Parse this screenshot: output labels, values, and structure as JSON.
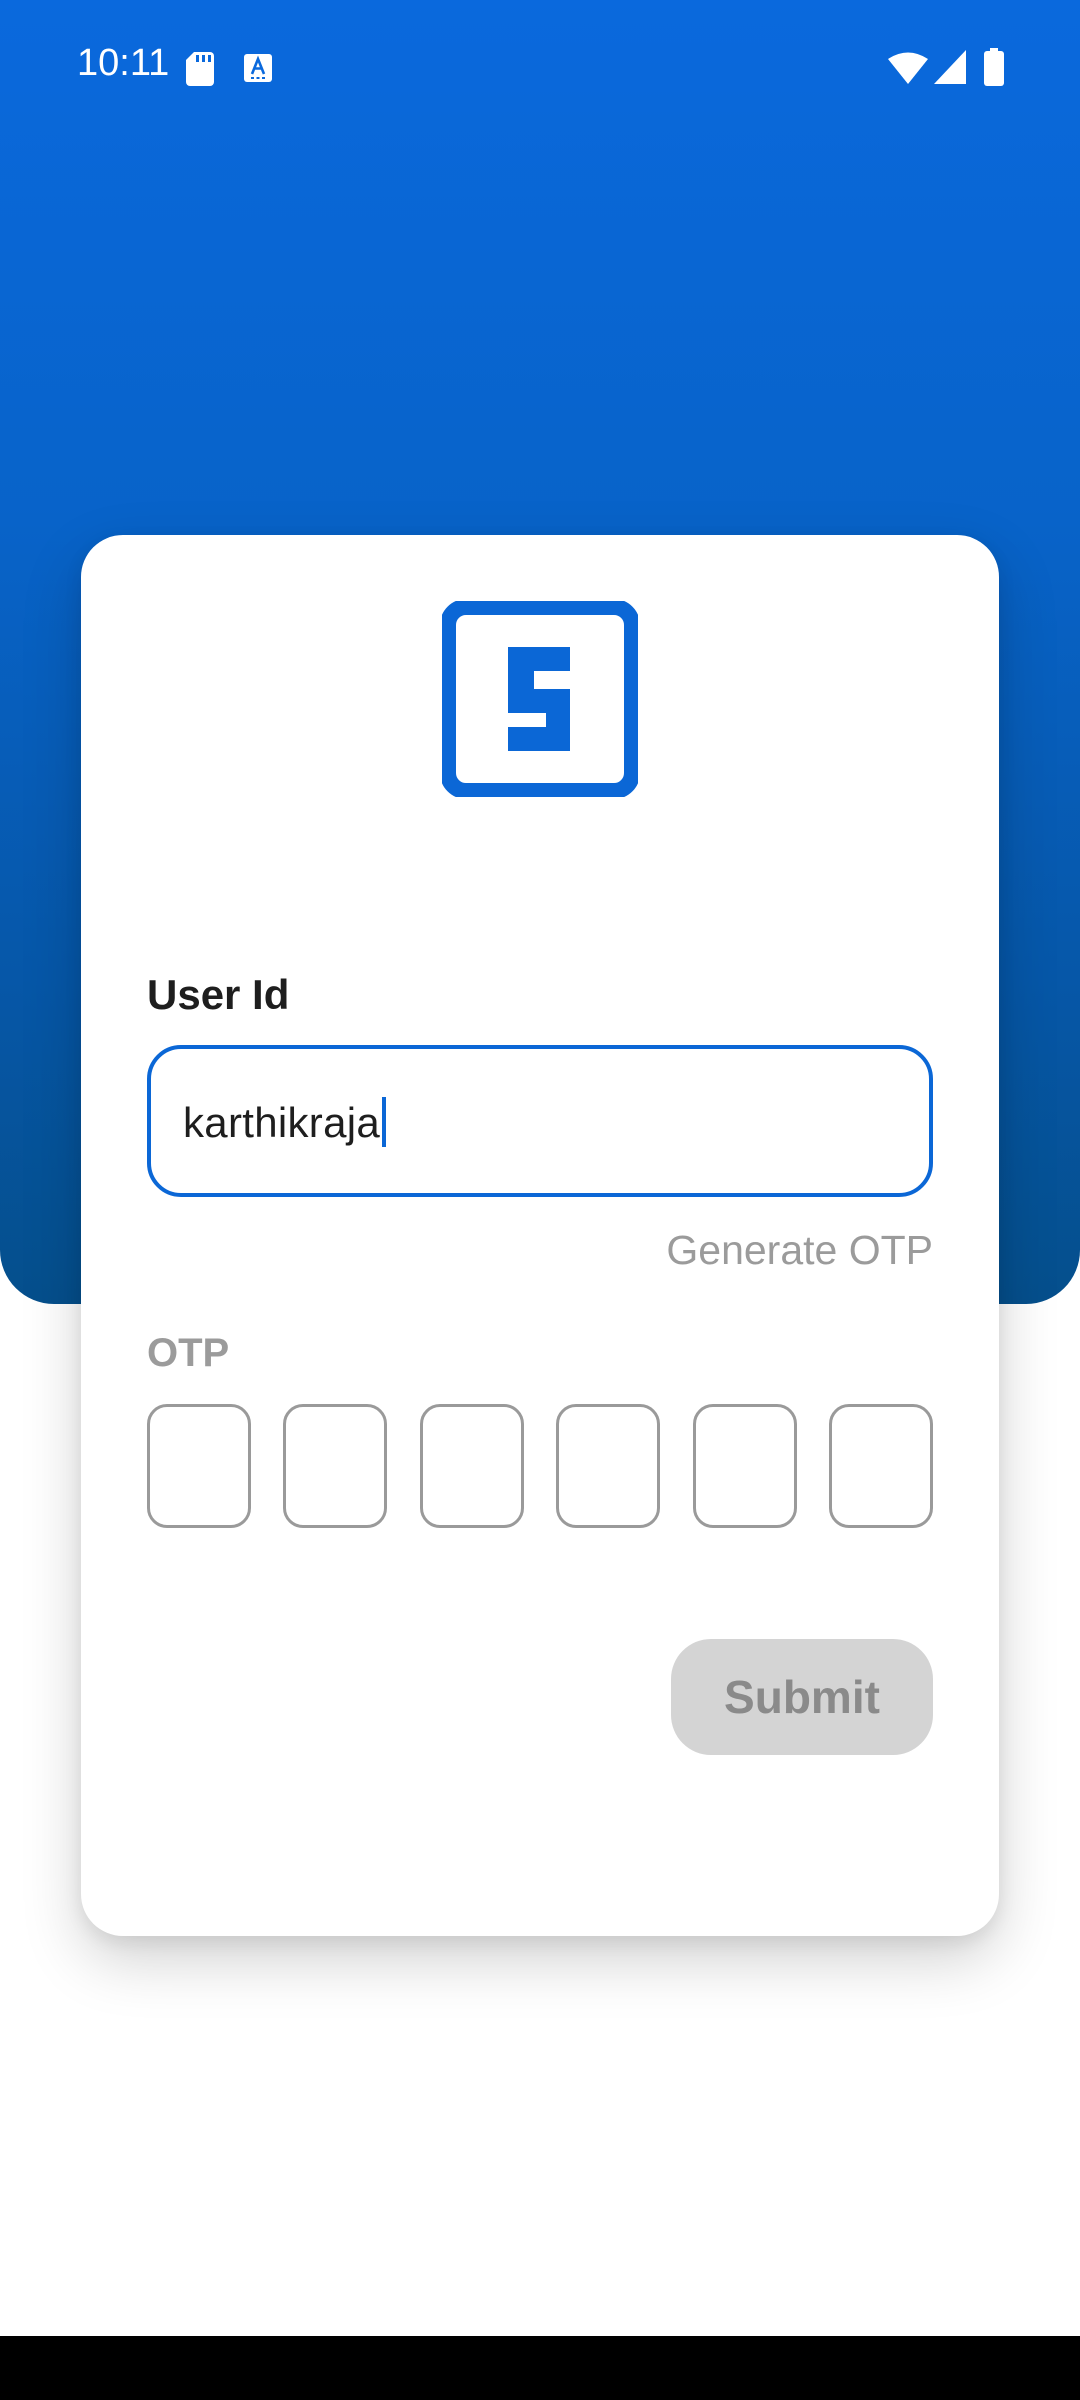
{
  "status_bar": {
    "time": "10:11",
    "icons": [
      "sd-card-icon",
      "text-input-icon",
      "wifi-icon",
      "signal-icon",
      "battery-icon"
    ]
  },
  "colors": {
    "brand_blue": "#0b67d6",
    "disabled_button": "#d4d4d4",
    "muted_text": "#9b9b9b"
  },
  "logo": {
    "icon": "s-logo-icon"
  },
  "form": {
    "user_id_label": "User Id",
    "user_id_value": "karthikraja",
    "generate_otp_label": "Generate OTP",
    "otp_label": "OTP",
    "otp_digits": [
      "",
      "",
      "",
      "",
      "",
      ""
    ],
    "submit_label": "Submit"
  }
}
